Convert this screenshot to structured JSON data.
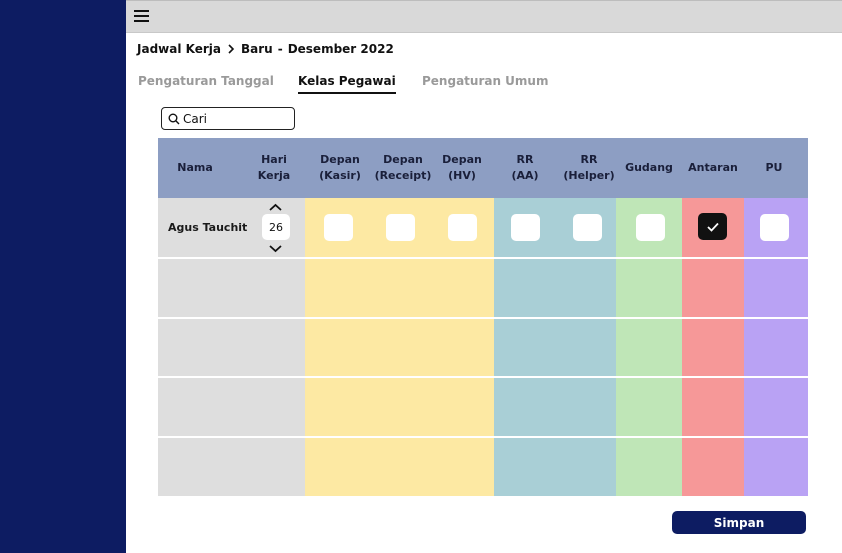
{
  "breadcrumb": {
    "part1": "Jadwal Kerja",
    "part2": "Baru",
    "dash": "-",
    "part3": "Desember 2022"
  },
  "tabs": [
    {
      "label": "Pengaturan Tanggal",
      "active": false
    },
    {
      "label": "Kelas Pegawai",
      "active": true
    },
    {
      "label": "Pengaturan Umum",
      "active": false
    }
  ],
  "search": {
    "value": "Cari"
  },
  "table": {
    "headers": {
      "nama": "Nama",
      "hari_kerja": "Hari\nKerja",
      "depan_kasir": "Depan\n(Kasir)",
      "depan_receipt": "Depan\n(Receipt)",
      "depan_hv": "Depan\n(HV)",
      "rr_aa": "RR\n(AA)",
      "rr_helper": "RR\n(Helper)",
      "gudang": "Gudang",
      "antaran": "Antaran",
      "pu": "PU"
    },
    "rows": [
      {
        "nama": "Agus Tauchit",
        "hari_kerja": "26",
        "depan_kasir": false,
        "depan_receipt": false,
        "depan_hv": false,
        "rr_aa": false,
        "rr_helper": false,
        "gudang": false,
        "antaran": true,
        "pu": false
      }
    ],
    "empty_rows": 4,
    "column_colors": {
      "nama": "#dedede",
      "hari_kerja": "#dedede",
      "depan": "#fde9a3",
      "rr": "#a9cfd6",
      "gudang": "#bfe6b7",
      "antaran": "#f69898",
      "pu": "#b9a2f4",
      "header": "#8d9ec3"
    }
  },
  "buttons": {
    "save": "Simpan"
  },
  "colors": {
    "sidebar": "#0d1c62",
    "topbar": "#d9d9d9",
    "accent": "#0d1c62"
  }
}
